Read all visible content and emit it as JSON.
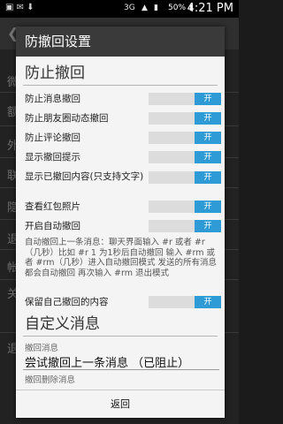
{
  "status_bar": {
    "signal": "3G",
    "battery": "50%",
    "time": "4:21 PM"
  },
  "background": {
    "row_chars": [
      "微",
      "额",
      "外",
      "联",
      "隐",
      "退",
      "帐",
      "关",
      "退"
    ]
  },
  "dialog": {
    "title": "防撤回设置",
    "section1_title": "防止撤回",
    "toggles": [
      {
        "label": "防止消息撤回",
        "state": "开"
      },
      {
        "label": "防止朋友圈动态撤回",
        "state": "开"
      },
      {
        "label": "防止评论撤回",
        "state": "开"
      },
      {
        "label": "显示撤回提示",
        "state": "开"
      },
      {
        "label": "显示已撤回内容(只支持文字)",
        "state": "开"
      },
      {
        "label": "查看红包照片",
        "state": "开"
      },
      {
        "label": "开启自动撤回",
        "state": "开"
      }
    ],
    "auto_recall_desc": "自动撤回上一条消息：聊天界面输入 #r 或者 #r（几秒）比如 #r 1 为1秒后自动撤回 输入 #rm 或者 #rm（几秒）进入自动撤回模式 发送的所有消息都会自动撤回 再次输入 #rm 退出模式",
    "keep_own_label": "保留自己撤回的内容",
    "keep_own_state": "开",
    "section2_title": "自定义消息",
    "custom_label": "撤回消息",
    "custom_value": "尝试撤回上一条消息 （已阻止）",
    "custom_next_label": "撤回删除消息",
    "back_label": "返回"
  }
}
